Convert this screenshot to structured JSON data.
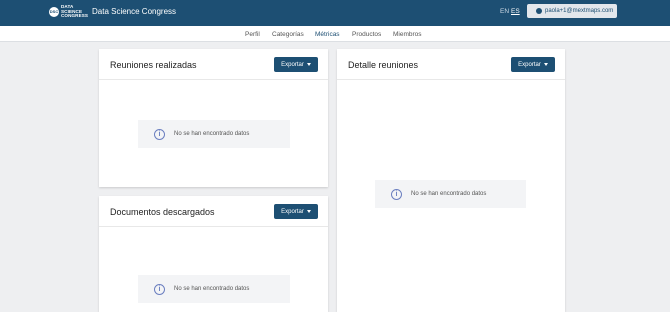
{
  "header": {
    "logo_badge": "DSC",
    "logo_lines": [
      "DATA",
      "SCIENCE",
      "CONGRESS"
    ],
    "title": "Data Science Congress",
    "lang_en": "EN",
    "lang_es": "ES",
    "user_email": "paola+1@mextmaps.com"
  },
  "nav": {
    "items": [
      "Perfil",
      "Categorías",
      "Métricas",
      "Productos",
      "Miembros"
    ],
    "active": "Métricas"
  },
  "cards": {
    "meetings": {
      "title": "Reuniones realizadas",
      "export_label": "Exportar",
      "empty_text": "No se han encontrado datos"
    },
    "documents": {
      "title": "Documentos descargados",
      "export_label": "Exportar",
      "empty_text": "No se han encontrado datos"
    },
    "details": {
      "title": "Detalle reuniones",
      "export_label": "Exportar",
      "empty_text": "No se han encontrado datos"
    }
  },
  "colors": {
    "primary": "#1d4f73",
    "info_icon": "#6b7fc0",
    "background": "#eeeff1"
  },
  "icons": {
    "info": "info-circle-icon",
    "user": "user-circle-icon",
    "caret": "caret-down-icon"
  }
}
